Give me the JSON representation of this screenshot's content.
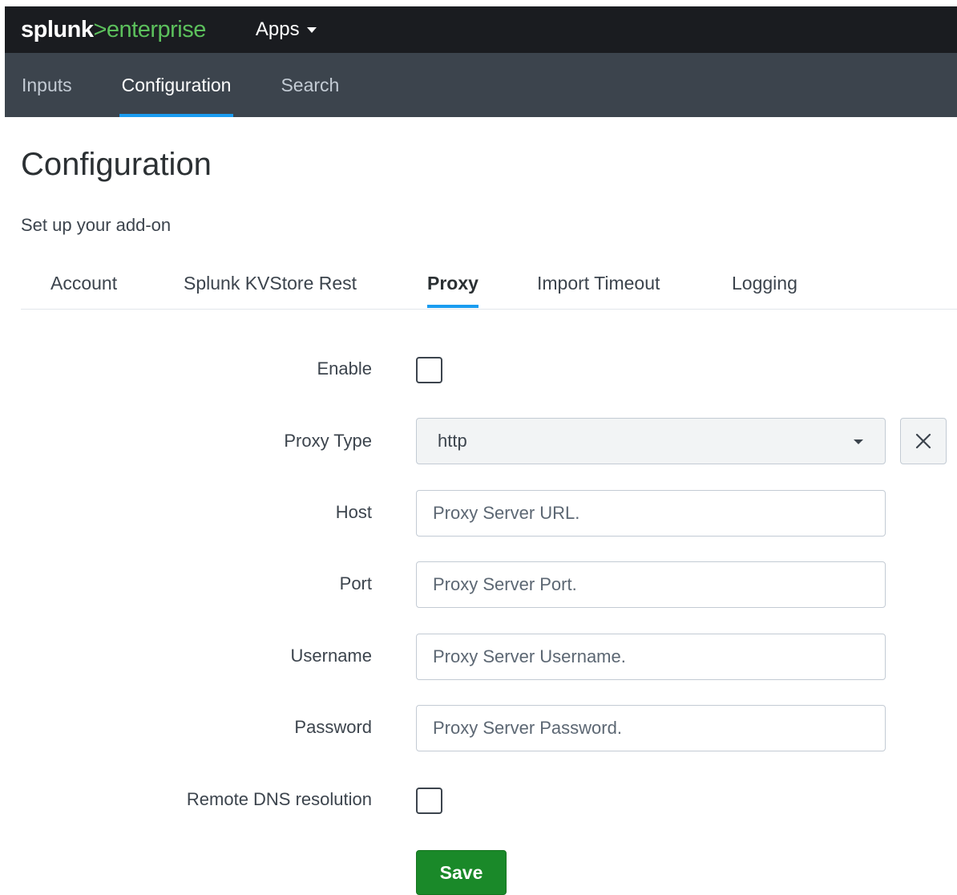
{
  "header": {
    "logo": {
      "brand": "splunk",
      "separator": ">",
      "product": "enterprise"
    },
    "apps_label": "Apps"
  },
  "app_nav": {
    "items": [
      {
        "label": "Inputs"
      },
      {
        "label": "Configuration",
        "active": true
      },
      {
        "label": "Search"
      }
    ]
  },
  "page": {
    "title": "Configuration",
    "subtitle": "Set up your add-on"
  },
  "tabs": [
    {
      "label": "Account"
    },
    {
      "label": "Splunk KVStore Rest"
    },
    {
      "label": "Proxy",
      "active": true
    },
    {
      "label": "Import Timeout"
    },
    {
      "label": "Logging"
    }
  ],
  "form": {
    "enable": {
      "label": "Enable",
      "checked": false
    },
    "proxy_type": {
      "label": "Proxy Type",
      "value": "http"
    },
    "host": {
      "label": "Host",
      "value": "",
      "placeholder": "Proxy Server URL."
    },
    "port": {
      "label": "Port",
      "value": "",
      "placeholder": "Proxy Server Port."
    },
    "username": {
      "label": "Username",
      "value": "",
      "placeholder": "Proxy Server Username."
    },
    "password": {
      "label": "Password",
      "value": "",
      "placeholder": "Proxy Server Password."
    },
    "remote_dns": {
      "label": "Remote DNS resolution",
      "checked": false
    },
    "save_label": "Save"
  },
  "colors": {
    "topbar": "#1a1c20",
    "appnav": "#3c444d",
    "accent_blue": "#1a9cf0",
    "logo_green": "#5cc05c",
    "save_green": "#1a8929"
  }
}
